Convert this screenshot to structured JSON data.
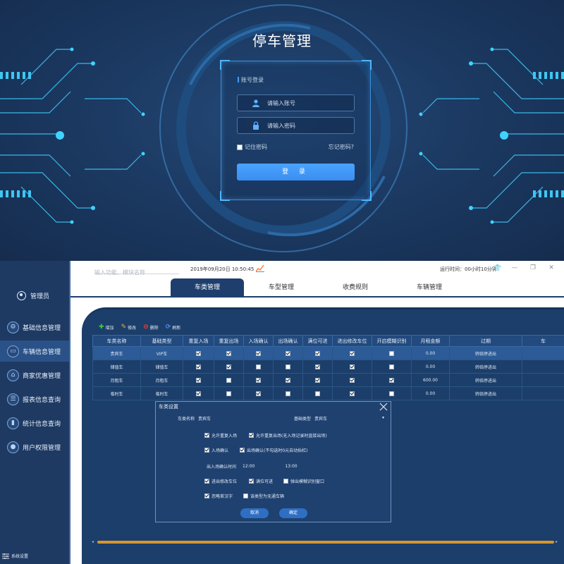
{
  "login": {
    "title": "停车管理",
    "box_header": "账号登录",
    "username_placeholder": "请输入账号",
    "password_placeholder": "请输入密码",
    "remember_label": "记住密码",
    "forgot_label": "忘记密码?",
    "login_button": "登 录"
  },
  "topbar": {
    "search_placeholder": "输入功能、模块名称",
    "datetime": "2019年09月20日 10:50:45",
    "runtime": "运行时间：00小时10分钟"
  },
  "sidebar": {
    "user": "管理员",
    "items": [
      {
        "label": "基础信息管理",
        "icon": "gear-icon"
      },
      {
        "label": "车辆信息管理",
        "icon": "car-icon"
      },
      {
        "label": "商家优惠管理",
        "icon": "shop-icon"
      },
      {
        "label": "报表信息查询",
        "icon": "report-icon"
      },
      {
        "label": "统计信息查询",
        "icon": "stats-icon"
      },
      {
        "label": "用户权限管理",
        "icon": "users-icon"
      }
    ],
    "footer": "系统设置"
  },
  "tabs": [
    "车类管理",
    "车型管理",
    "收费规则",
    "车辆管理"
  ],
  "toolbar": {
    "add": "增加",
    "edit": "修改",
    "delete": "删除",
    "refresh": "刷新"
  },
  "table": {
    "headers": [
      "车类名称",
      "基础类型",
      "重复入场",
      "重复出场",
      "入场确认",
      "出场确认",
      "满位可进",
      "进出修改车位",
      "开启模糊识别",
      "月租金额",
      "过期",
      "车"
    ],
    "rows": [
      {
        "name": "贵宾车",
        "type": "VIP车",
        "checks": [
          true,
          true,
          true,
          true,
          true,
          true,
          false
        ],
        "amount": "0.00",
        "expire": "转临停进出"
      },
      {
        "name": "储值车",
        "type": "储值车",
        "checks": [
          true,
          true,
          false,
          false,
          true,
          true,
          false
        ],
        "amount": "0.00",
        "expire": "转临停进出"
      },
      {
        "name": "月租车",
        "type": "月租车",
        "checks": [
          true,
          false,
          true,
          true,
          true,
          true,
          true
        ],
        "amount": "600.00",
        "expire": "转临停进出"
      },
      {
        "name": "临时车",
        "type": "临时车",
        "checks": [
          true,
          false,
          true,
          false,
          false,
          true,
          false
        ],
        "amount": "0.00",
        "expire": "转临停进出"
      }
    ]
  },
  "dialog": {
    "title": "车类设置",
    "name_label": "车类名称",
    "name_value": "贵宾车",
    "base_label": "基础类型",
    "base_value": "贵宾车",
    "opt_repeat_in": "允许重复入场",
    "opt_repeat_out": "允许重复出场(无入场记录时直接出场)",
    "opt_in_confirm": "入场确认",
    "opt_out_confirm": "出场确认(不勾选时0元自动抬杠)",
    "time_label": "出入场确认时间",
    "time_start": "12:00",
    "time_end": "13:00",
    "opt_modify_slot": "进出修改车位",
    "opt_full_enter": "满位可进",
    "opt_fuzzy": "弹出模糊识别窗口",
    "opt_ignore_cn": "忽略首汉字",
    "opt_no_vehicle": "该类型为无通车辆",
    "cancel": "取消",
    "ok": "确定"
  },
  "colors": {
    "sidebar_bg": "#1e3a63",
    "panel_bg": "#1c3e6a",
    "accent": "#3a8ef0",
    "scrollbar": "#d6962c"
  }
}
